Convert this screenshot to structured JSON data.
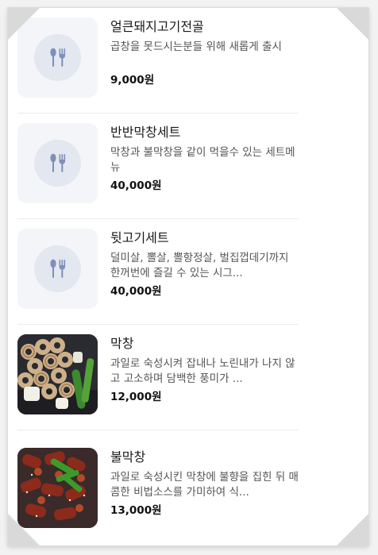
{
  "menu": {
    "items": [
      {
        "name": "얼큰돼지고기전골",
        "desc": "곱창을 못드시는분들 위해 새롭게 출시",
        "price": "9,000원",
        "image": "placeholder-icon"
      },
      {
        "name": "반반막창세트",
        "desc": "막창과 불막창을 같이 먹을수 있는 세트메뉴",
        "price": "40,000원",
        "image": "placeholder-icon"
      },
      {
        "name": "뒷고기세트",
        "desc": "덜미살, 뽈살, 뽈항정살, 벌집껍데기까지 한꺼번에 즐길 수 있는 시그...",
        "price": "40,000원",
        "image": "placeholder-icon"
      },
      {
        "name": "막창",
        "desc": "과일로 숙성시켜 잡내나 노린내가 나지 않고 고소하며 담백한 풍미가 ...",
        "price": "12,000원",
        "image": "grilled-makchang-photo"
      },
      {
        "name": "불막창",
        "desc": "과일로 숙성시킨 막창에 불향을 집힌 뒤 매콤한 비법소스를 가미하여 식...",
        "price": "13,000원",
        "image": "spicy-makchang-photo"
      }
    ]
  },
  "colors": {
    "placeholder_bg": "#f4f5f8",
    "placeholder_circle": "#e3e7ef",
    "utensil_icon": "#7f8fb8"
  }
}
